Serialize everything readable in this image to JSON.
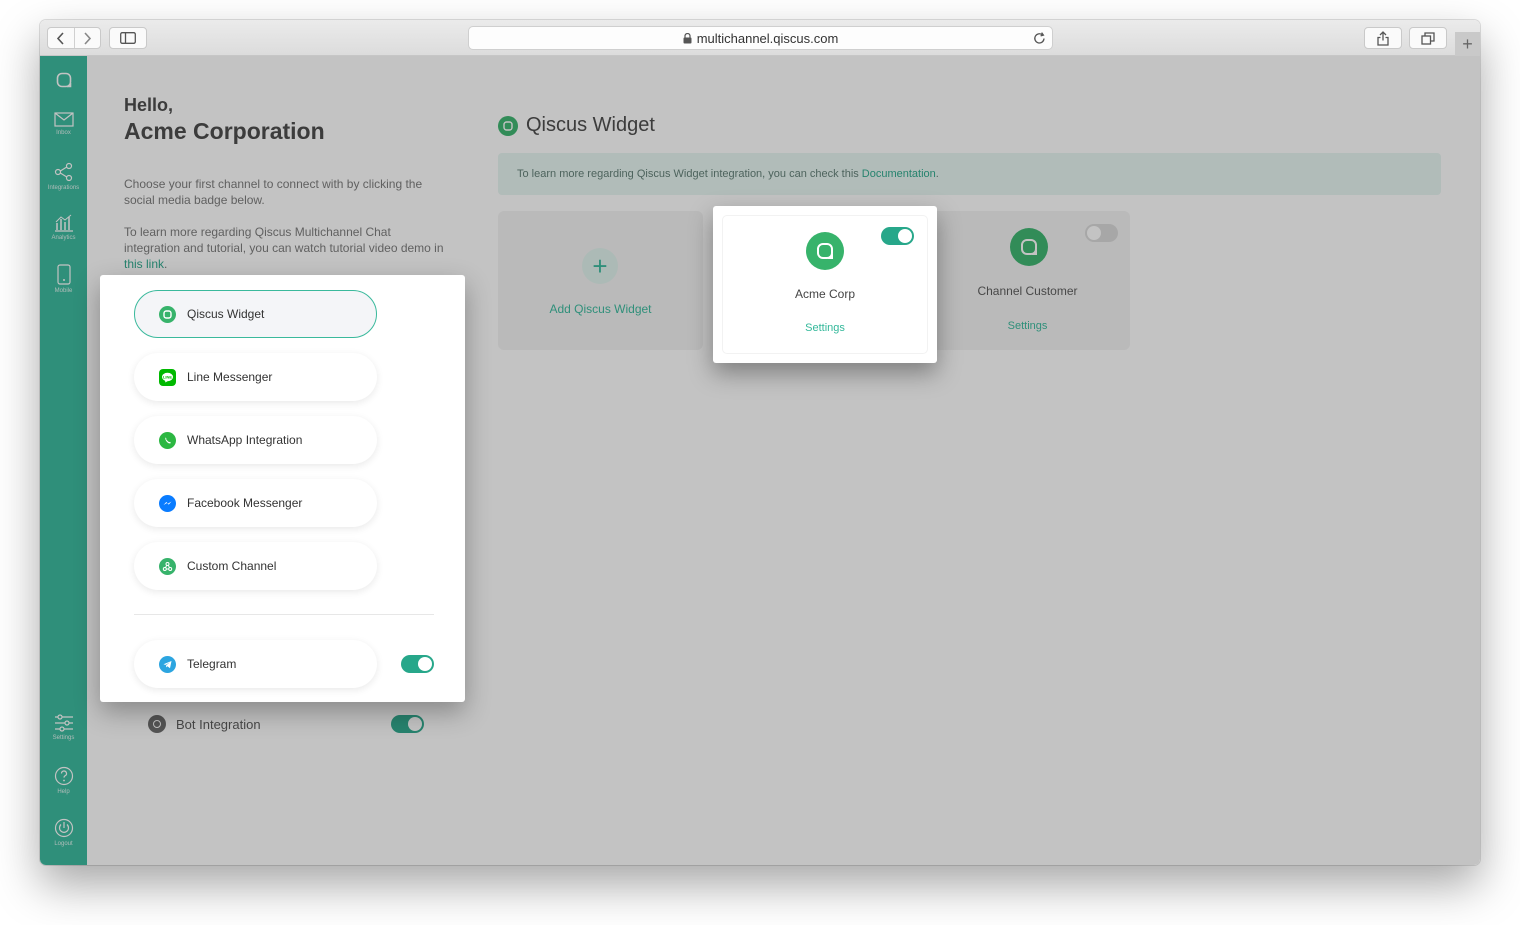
{
  "browser": {
    "url": "multichannel.qiscus.com",
    "new_tab_glyph": "+"
  },
  "sidebar": {
    "items": [
      {
        "id": "logo",
        "label": ""
      },
      {
        "id": "inbox",
        "label": "Inbox"
      },
      {
        "id": "integrations",
        "label": "Integrations"
      },
      {
        "id": "analytics",
        "label": "Analytics"
      },
      {
        "id": "mobile",
        "label": "Mobile"
      },
      {
        "id": "settings",
        "label": "Settings"
      },
      {
        "id": "help",
        "label": "Help"
      },
      {
        "id": "logout",
        "label": "Logout"
      }
    ]
  },
  "greeting": {
    "hello": "Hello,",
    "name": "Acme Corporation"
  },
  "intro": {
    "line1": "Choose your first channel to connect with by clicking the social media badge below.",
    "line2": "To learn more regarding Qiscus Multichannel Chat integration and tutorial, you can watch tutorial video demo in ",
    "link": "this link",
    "end": "."
  },
  "channels": [
    {
      "label": "Qiscus Widget",
      "icon": "qiscus-icon",
      "color": "#37b36b",
      "selected": true
    },
    {
      "label": "Line Messenger",
      "icon": "line-icon",
      "color": "#00b900"
    },
    {
      "label": "WhatsApp Integration",
      "icon": "whatsapp-icon",
      "color": "#2cb742"
    },
    {
      "label": "Facebook Messenger",
      "icon": "messenger-icon",
      "color": "#0a7cff"
    },
    {
      "label": "Custom Channel",
      "icon": "custom-channel-icon",
      "color": "#37b36b"
    }
  ],
  "telegram": {
    "label": "Telegram",
    "icon": "telegram-icon",
    "color": "#2ca5e0",
    "enabled": true
  },
  "bot": {
    "label": "Bot Integration",
    "enabled": true
  },
  "widget_section": {
    "title": "Qiscus Widget",
    "info_text": "To learn more regarding Qiscus Widget integration, you can check this ",
    "info_link": "Documentation",
    "info_end": ".",
    "add_label": "Add Qiscus Widget",
    "add_glyph": "+",
    "cards": [
      {
        "name": "Acme Corp",
        "settings": "Settings",
        "enabled": true
      },
      {
        "name": "Channel Customer",
        "settings": "Settings",
        "enabled": false
      }
    ]
  },
  "colors": {
    "accent": "#33b89a",
    "toggle_on": "#27a78a"
  }
}
